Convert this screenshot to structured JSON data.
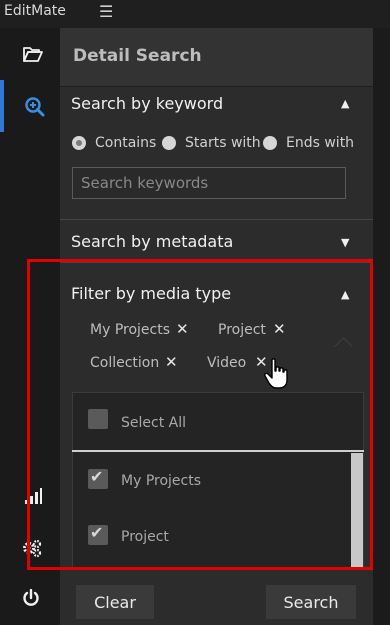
{
  "app": {
    "title": "EditMate"
  },
  "panel": {
    "title": "Detail Search"
  },
  "keyword_section": {
    "title": "Search by keyword",
    "options": [
      "Contains",
      "Starts with",
      "Ends with"
    ],
    "selected": "Contains",
    "placeholder": "Search keywords"
  },
  "metadata_section": {
    "title": "Search by metadata"
  },
  "media_type_section": {
    "title": "Filter by media type",
    "chips": [
      "My Projects",
      "Project",
      "Collection",
      "Video"
    ],
    "dropdown": {
      "select_all": "Select All",
      "options": [
        {
          "label": "My Projects",
          "checked": true
        },
        {
          "label": "Project",
          "checked": true
        }
      ]
    }
  },
  "footer": {
    "clear_label": "Clear",
    "search_label": "Search"
  },
  "icons": {
    "menu": "hamburger-icon",
    "folder": "folder-icon",
    "search": "search-zoom-icon",
    "chart": "signal-chart-icon",
    "settings": "gears-icon",
    "power": "power-icon",
    "collapse": "triangle-up-icon",
    "expand": "triangle-down-icon",
    "remove": "close-icon",
    "check": "check-icon",
    "cursor": "hand-pointer-icon"
  },
  "colors": {
    "accent": "#2f7ad8",
    "highlight": "#e30000"
  }
}
